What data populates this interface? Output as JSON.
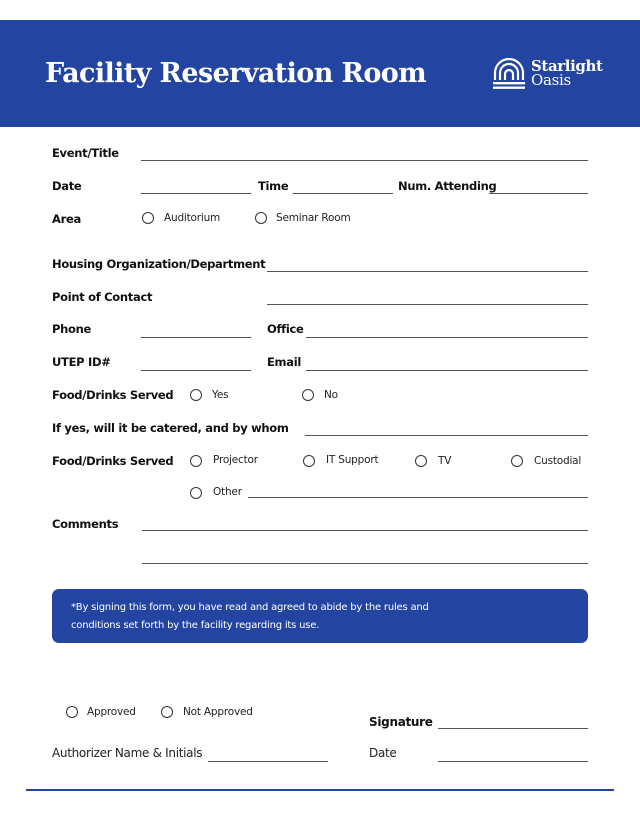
{
  "header": {
    "title": "Facility Reservation Room",
    "brand_line1": "Starlight",
    "brand_line2": "Oasis",
    "logo_icon": "arch-building-icon",
    "color": "#2344a0"
  },
  "form": {
    "event_title_label": "Event/Title",
    "date_label": "Date",
    "time_label": "Time",
    "num_attending_label": "Num. Attending",
    "area_label": "Area",
    "area_options": [
      "Auditorium",
      "Seminar Room"
    ],
    "housing_org_label": "Housing Organization/Department",
    "point_of_contact_label": "Point of Contact",
    "phone_label": "Phone",
    "office_label": "Office",
    "utep_id_label": "UTEP ID#",
    "email_label": "Email",
    "food_label": "Food/Drinks Served",
    "food_options": [
      "Yes",
      "No"
    ],
    "catered_label": "If yes, will it be catered, and by whom",
    "services_label": "Food/Drinks Served",
    "services_options": [
      "Projector",
      "IT Support",
      "TV",
      "Custodial",
      "Other"
    ],
    "comments_label": "Comments"
  },
  "notice": {
    "text": "*By signing this form, you have read and agreed to abide by the rules and conditions set forth by the facility regarding its use."
  },
  "approval": {
    "options": [
      "Approved",
      "Not Approved"
    ],
    "signature_label": "Signature",
    "authorizer_label": "Authorizer Name & Initials",
    "date_label": "Date"
  }
}
